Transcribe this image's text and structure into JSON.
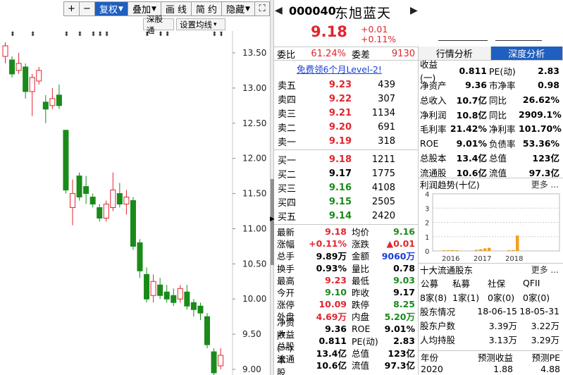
{
  "toolbar": {
    "plus": "+",
    "minus": "−",
    "fuquan": "复权",
    "diejia": "叠加",
    "huaxian": "画 线",
    "jianyue": "简 约",
    "yincang": "隐藏",
    "expand": "⛶",
    "shengutong": "深股通",
    "shezhi_junxian": "设置均线"
  },
  "chart": {
    "y_ticks": [
      "13.50",
      "13.00",
      "12.50",
      "12.00",
      "11.50",
      "11.00",
      "10.50",
      "10.00",
      "9.50",
      "9.00"
    ],
    "up_color": "#e0262e",
    "down_color": "#1a8a1a"
  },
  "chart_data": {
    "type": "candlestick",
    "ylim": [
      8.9,
      13.8
    ],
    "candles": [
      {
        "o": 13.45,
        "c": 13.6,
        "h": 13.65,
        "l": 13.35
      },
      {
        "o": 13.4,
        "c": 13.2,
        "h": 13.45,
        "l": 13.15
      },
      {
        "o": 13.25,
        "c": 13.35,
        "h": 13.5,
        "l": 13.2
      },
      {
        "o": 13.3,
        "c": 12.95,
        "h": 13.35,
        "l": 12.85
      },
      {
        "o": 12.95,
        "c": 13.15,
        "h": 13.2,
        "l": 12.6
      },
      {
        "o": 13.1,
        "c": 13.25,
        "h": 13.3,
        "l": 13.05
      },
      {
        "o": 12.8,
        "c": 12.7,
        "h": 12.9,
        "l": 12.5
      },
      {
        "o": 12.75,
        "c": 12.85,
        "h": 13.0,
        "l": 12.7
      },
      {
        "o": 12.9,
        "c": 12.75,
        "h": 13.05,
        "l": 12.7
      },
      {
        "o": 12.4,
        "c": 11.55,
        "h": 12.4,
        "l": 11.5
      },
      {
        "o": 11.3,
        "c": 11.5,
        "h": 11.7,
        "l": 11.05
      },
      {
        "o": 11.75,
        "c": 11.45,
        "h": 11.8,
        "l": 11.4
      },
      {
        "o": 11.6,
        "c": 11.5,
        "h": 11.75,
        "l": 11.35
      },
      {
        "o": 11.45,
        "c": 11.35,
        "h": 11.5,
        "l": 11.3
      },
      {
        "o": 11.3,
        "c": 11.15,
        "h": 11.35,
        "l": 11.1
      },
      {
        "o": 11.15,
        "c": 11.35,
        "h": 11.4,
        "l": 11.1
      },
      {
        "o": 11.3,
        "c": 11.55,
        "h": 11.8,
        "l": 11.25
      },
      {
        "o": 11.5,
        "c": 11.35,
        "h": 11.65,
        "l": 11.3
      },
      {
        "o": 11.35,
        "c": 11.45,
        "h": 11.55,
        "l": 11.2
      },
      {
        "o": 11.4,
        "c": 10.75,
        "h": 11.45,
        "l": 10.7
      },
      {
        "o": 10.8,
        "c": 10.4,
        "h": 10.85,
        "l": 10.3
      },
      {
        "o": 10.35,
        "c": 10.0,
        "h": 10.45,
        "l": 9.95
      },
      {
        "o": 10.05,
        "c": 10.25,
        "h": 10.35,
        "l": 9.95
      },
      {
        "o": 10.2,
        "c": 10.05,
        "h": 10.3,
        "l": 10.0
      },
      {
        "o": 10.1,
        "c": 10.0,
        "h": 10.2,
        "l": 9.95
      },
      {
        "o": 10.05,
        "c": 9.95,
        "h": 10.15,
        "l": 9.9
      },
      {
        "o": 10.0,
        "c": 10.15,
        "h": 10.2,
        "l": 9.95
      },
      {
        "o": 10.1,
        "c": 9.9,
        "h": 10.2,
        "l": 9.85
      },
      {
        "o": 9.95,
        "c": 9.85,
        "h": 10.0,
        "l": 9.75
      },
      {
        "o": 9.9,
        "c": 9.8,
        "h": 9.95,
        "l": 9.7
      },
      {
        "o": 9.75,
        "c": 9.35,
        "h": 9.8,
        "l": 9.3
      },
      {
        "o": 9.25,
        "c": 8.95,
        "h": 9.3,
        "l": 8.9
      },
      {
        "o": 9.05,
        "c": 9.2,
        "h": 9.3,
        "l": 9.0
      }
    ],
    "markers": [
      1,
      4,
      9,
      11,
      13,
      14,
      15,
      21,
      23,
      24,
      31,
      32
    ]
  },
  "quote": {
    "nav_left": "◀",
    "nav_right": "▶",
    "code": "000040",
    "name": "东旭蓝天",
    "price": "9.18",
    "change": "+0.01",
    "change_pct": "+0.11%",
    "weibi_label": "委比",
    "weibi": "61.24%",
    "weicha_label": "委差",
    "weicha": "9130",
    "ad": "免费领6个月Level-2!"
  },
  "orderbook": {
    "asks": [
      {
        "label": "卖五",
        "price": "9.23",
        "vol": "439",
        "color": "red"
      },
      {
        "label": "卖四",
        "price": "9.22",
        "vol": "307",
        "color": "red"
      },
      {
        "label": "卖三",
        "price": "9.21",
        "vol": "1134",
        "color": "red"
      },
      {
        "label": "卖二",
        "price": "9.20",
        "vol": "691",
        "color": "red"
      },
      {
        "label": "卖一",
        "price": "9.19",
        "vol": "318",
        "color": "red"
      }
    ],
    "bids": [
      {
        "label": "买一",
        "price": "9.18",
        "vol": "1211",
        "color": "red"
      },
      {
        "label": "买二",
        "price": "9.17",
        "vol": "1775",
        "color": "black"
      },
      {
        "label": "买三",
        "price": "9.16",
        "vol": "4108",
        "color": "green"
      },
      {
        "label": "买四",
        "price": "9.15",
        "vol": "2505",
        "color": "green"
      },
      {
        "label": "买五",
        "price": "9.14",
        "vol": "2420",
        "color": "green"
      }
    ]
  },
  "stats": [
    {
      "k1": "最新",
      "v1": "9.18",
      "c1": "red",
      "k2": "均价",
      "v2": "9.16",
      "c2": "green"
    },
    {
      "k1": "涨幅",
      "v1": "+0.11%",
      "c1": "red",
      "k2": "涨跌",
      "v2": "▲0.01",
      "c2": "red"
    },
    {
      "k1": "总手",
      "v1": "9.89万",
      "c1": "black",
      "k2": "金额",
      "v2": "9060万",
      "c2": "blue"
    },
    {
      "k1": "换手",
      "v1": "0.93%",
      "c1": "black",
      "k2": "量比",
      "v2": "0.78",
      "c2": "black"
    },
    {
      "k1": "最高",
      "v1": "9.23",
      "c1": "red",
      "k2": "最低",
      "v2": "9.03",
      "c2": "green"
    },
    {
      "k1": "今开",
      "v1": "9.10",
      "c1": "green",
      "k2": "昨收",
      "v2": "9.17",
      "c2": "black"
    },
    {
      "k1": "涨停",
      "v1": "10.09",
      "c1": "red",
      "k2": "跌停",
      "v2": "8.25",
      "c2": "green"
    },
    {
      "k1": "外盘",
      "v1": "4.69万",
      "c1": "red",
      "k2": "内盘",
      "v2": "5.20万",
      "c2": "green"
    },
    {
      "k1": "净资产",
      "v1": "9.36",
      "c1": "black",
      "k2": "ROE",
      "v2": "9.01%",
      "c2": "black"
    },
    {
      "k1": "收益(一)",
      "v1": "0.811",
      "c1": "black",
      "k2": "PE(动)",
      "v2": "2.83",
      "c2": "black"
    },
    {
      "k1": "总股本",
      "v1": "13.4亿",
      "c1": "black",
      "k2": "总值",
      "v2": "123亿",
      "c2": "black"
    },
    {
      "k1": "流通股",
      "v1": "10.6亿",
      "c1": "black",
      "k2": "流值",
      "v2": "97.3亿",
      "c2": "black"
    }
  ],
  "tabs": {
    "t1": "行情分析",
    "t2": "深度分析"
  },
  "fundamentals": [
    {
      "a": "收益(一)",
      "b": "0.811",
      "c": "PE(动)",
      "d": "2.83"
    },
    {
      "a": "净资产",
      "b": "9.36",
      "c": "市净率",
      "d": "0.98"
    },
    {
      "a": "总收入",
      "b": "10.7亿",
      "c": "同比",
      "d": "26.62%"
    },
    {
      "a": "净利润",
      "b": "10.8亿",
      "c": "同比",
      "d": "2909.1%"
    },
    {
      "a": "毛利率",
      "b": "21.42%",
      "c": "净利率",
      "d": "101.70%"
    },
    {
      "a": "ROE",
      "b": "9.01%",
      "c": "负债率",
      "d": "53.36%"
    },
    {
      "a": "总股本",
      "b": "13.4亿",
      "c": "总值",
      "d": "123亿"
    },
    {
      "a": "流通股",
      "b": "10.6亿",
      "c": "流值",
      "d": "97.3亿"
    }
  ],
  "profit_trend": {
    "title": "利润趋势(十亿)",
    "more": "更多",
    "y_ticks": [
      "4",
      "3",
      "2",
      "1",
      "0"
    ],
    "years": [
      "2016",
      "2017",
      "2018"
    ],
    "bars": [
      0.05,
      0.05,
      0.06,
      0.05,
      0.08,
      0.12,
      0.18,
      0.22,
      0.05,
      0.06,
      1.08
    ],
    "bar_color": "#f0a020"
  },
  "top10": {
    "title": "十大流通股东",
    "more": "更多",
    "heads": [
      "公募",
      "私募",
      "社保",
      "QFII"
    ],
    "vals": [
      "8家(8)",
      "1家(1)",
      "0家(0)",
      "0家(0)"
    ],
    "rows": [
      {
        "k": "股东情况",
        "a": "18-06-15",
        "b": "18-05-31"
      },
      {
        "k": "股东户数",
        "a": "3.39万",
        "b": "3.22万"
      },
      {
        "k": "人均持股",
        "a": "3.13万",
        "b": "3.29万"
      }
    ]
  },
  "forecast": {
    "h1": "年份",
    "h2": "预测收益",
    "h3": "预测PE",
    "year": "2020",
    "eps": "1.88",
    "pe": "4.88"
  }
}
